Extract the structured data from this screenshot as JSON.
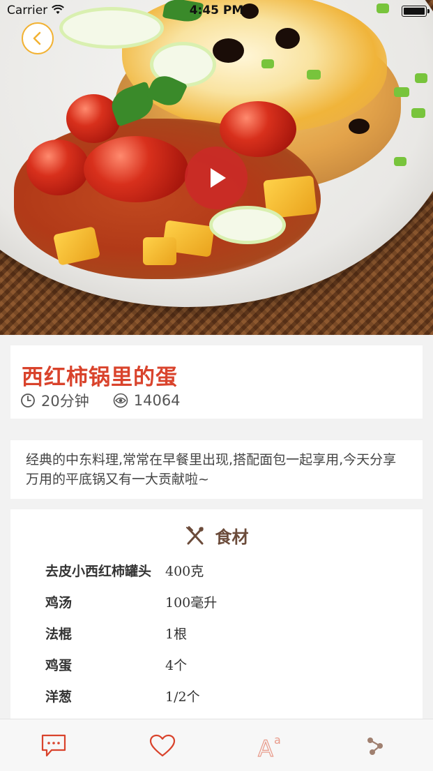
{
  "status_bar": {
    "carrier": "Carrier",
    "time": "4:45 PM"
  },
  "recipe": {
    "title": "西红柿锅里的蛋",
    "duration": "20分钟",
    "views": "14064",
    "description": "经典的中东料理,常常在早餐里出现,搭配面包一起享用,今天分享万用的平底锅又有一大贡献啦~"
  },
  "ingredients": {
    "heading": "食材",
    "items": [
      {
        "name": "去皮小西红柿罐头",
        "qty": "400克"
      },
      {
        "name": "鸡汤",
        "qty": "100毫升"
      },
      {
        "name": "法棍",
        "qty": "1根"
      },
      {
        "name": "鸡蛋",
        "qty": "4个"
      },
      {
        "name": "洋葱",
        "qty": "1/2个"
      }
    ]
  },
  "tabbar": {
    "icons": [
      "comment-icon",
      "heart-icon",
      "font-size-icon",
      "share-icon"
    ],
    "font_icon_text": "A",
    "font_icon_small": "a"
  },
  "colors": {
    "accent": "#d9432c",
    "back_border": "#f2b233",
    "play": "#cd2828"
  }
}
